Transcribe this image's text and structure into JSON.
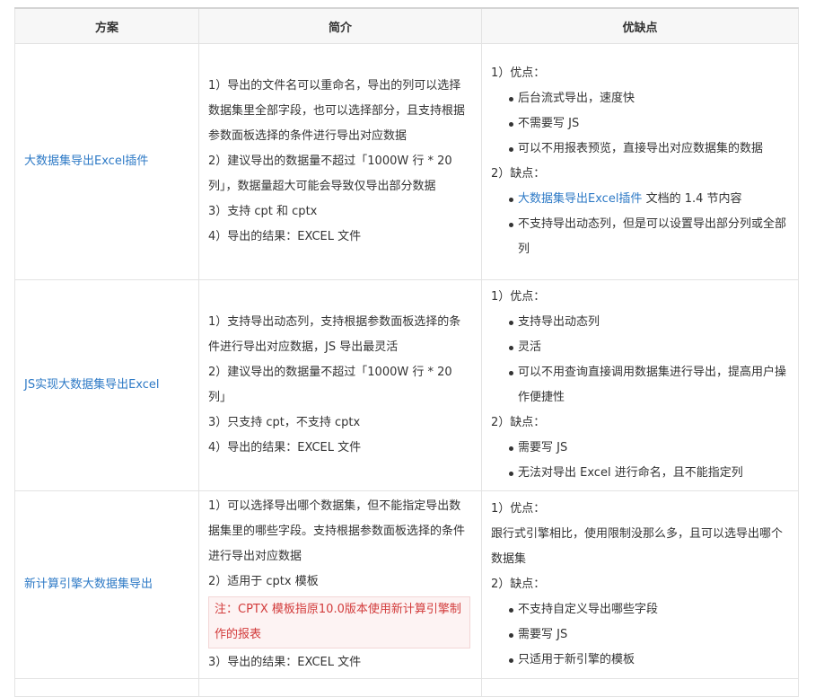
{
  "header": {
    "col1": "方案",
    "col2": "简介",
    "col3": "优缺点"
  },
  "rows": [
    {
      "name": "大数据集导出Excel插件",
      "intro": [
        "1）导出的文件名可以重命名，导出的列可以选择数据集里全部字段，也可以选择部分，且支持根据参数面板选择的条件进行导出对应数据",
        "2）建议导出的数据量不超过「1000W 行 * 20 列」，数据量超大可能会导致仅导出部分数据",
        "3）支持 cpt 和 cptx",
        "4）导出的结果：EXCEL 文件"
      ],
      "pros_title": "1）优点：",
      "pros": [
        "后台流式导出，速度快",
        "不需要写 JS",
        "可以不用报表预览，直接导出对应数据集的数据"
      ],
      "cons_title": "2）缺点：",
      "cons_link": "大数据集导出Excel插件",
      "cons_link_rest": " 文档的 1.4 节内容",
      "cons": [
        "不支持导出动态列，但是可以设置导出部分列或全部列"
      ]
    },
    {
      "name": "JS实现大数据集导出Excel",
      "intro": [
        "1）支持导出动态列，支持根据参数面板选择的条件进行导出对应数据，JS 导出最灵活",
        "2）建议导出的数据量不超过「1000W 行 * 20 列」",
        "3）只支持 cpt，不支持 cptx",
        "4）导出的结果：EXCEL 文件"
      ],
      "pros_title": "1）优点：",
      "pros": [
        "支持导出动态列",
        "灵活",
        "可以不用查询直接调用数据集进行导出，提高用户操作便捷性"
      ],
      "cons_title": "2）缺点：",
      "cons": [
        "需要写 JS",
        "无法对导出 Excel 进行命名，且不能指定列"
      ]
    },
    {
      "name": "新计算引擎大数据集导出",
      "intro": [
        "1）可以选择导出哪个数据集，但不能指定导出数据集里的哪些字段。支持根据参数面板选择的条件进行导出对应数据",
        "2）适用于 cptx 模板"
      ],
      "note": "注：CPTX 模板指原10.0版本使用新计算引擎制作的报表",
      "intro_after": [
        "3）导出的结果：EXCEL 文件"
      ],
      "pros_title": "1）优点：",
      "pros_text": "跟行式引擎相比，使用限制没那么多，且可以选导出哪个数据集",
      "cons_title": "2）缺点：",
      "cons": [
        "不支持自定义导出哪些字段",
        "需要写 JS",
        "只适用于新引擎的模板"
      ]
    }
  ]
}
